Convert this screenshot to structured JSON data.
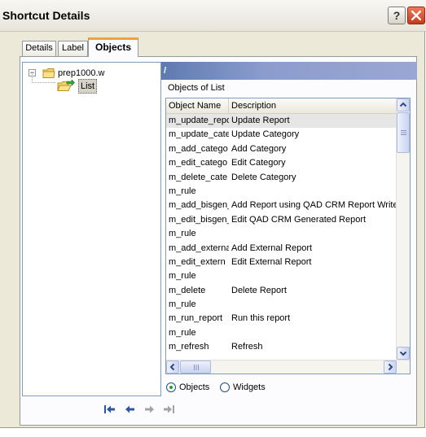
{
  "window": {
    "title": "Shortcut Details"
  },
  "title_buttons": {
    "help": "?"
  },
  "tabs": [
    {
      "label": "Details",
      "active": false
    },
    {
      "label": "Label",
      "active": false
    },
    {
      "label": "Objects",
      "active": true
    }
  ],
  "tree": {
    "root": {
      "label": "prep1000.w",
      "expander": "−",
      "icon": "folder-icon"
    },
    "child": {
      "label": "List",
      "icon": "open-folder-arrow-icon"
    }
  },
  "header_band": {
    "text": "/"
  },
  "objects_list": {
    "title": "Objects of List",
    "columns": [
      "Object Name",
      "Description"
    ],
    "rows": [
      {
        "name": "m_update_repo",
        "description": "Update Report",
        "selected": true
      },
      {
        "name": "m_update_cate",
        "description": "Update Category"
      },
      {
        "name": "m_add_catego",
        "description": "Add Category"
      },
      {
        "name": "m_edit_catego",
        "description": "Edit Category"
      },
      {
        "name": "m_delete_cate",
        "description": "Delete Category"
      },
      {
        "name": "m_rule",
        "description": ""
      },
      {
        "name": "m_add_bisgen_",
        "description": "Add Report using QAD CRM Report Writer"
      },
      {
        "name": "m_edit_bisgen_",
        "description": "Edit QAD CRM Generated Report"
      },
      {
        "name": "m_rule",
        "description": ""
      },
      {
        "name": "m_add_externa",
        "description": "Add External Report"
      },
      {
        "name": "m_edit_extern",
        "description": "Edit External Report"
      },
      {
        "name": "m_rule",
        "description": ""
      },
      {
        "name": "m_delete",
        "description": "Delete Report"
      },
      {
        "name": "m_rule",
        "description": ""
      },
      {
        "name": "m_run_report",
        "description": "Run this report"
      },
      {
        "name": "m_rule",
        "description": ""
      },
      {
        "name": "m_refresh",
        "description": "Refresh"
      }
    ]
  },
  "view_mode": {
    "options": [
      {
        "label": "Objects",
        "checked": true
      },
      {
        "label": "Widgets",
        "checked": false
      }
    ]
  },
  "navigation": {
    "buttons": [
      "first-record-icon",
      "prev-record-icon",
      "next-record-icon",
      "last-record-icon"
    ]
  },
  "colors": {
    "active_tab_accent": "#f1a13a",
    "header_band": "#8b9ccd",
    "close_button": "#c53a1b",
    "radio_dot": "#21a121"
  }
}
